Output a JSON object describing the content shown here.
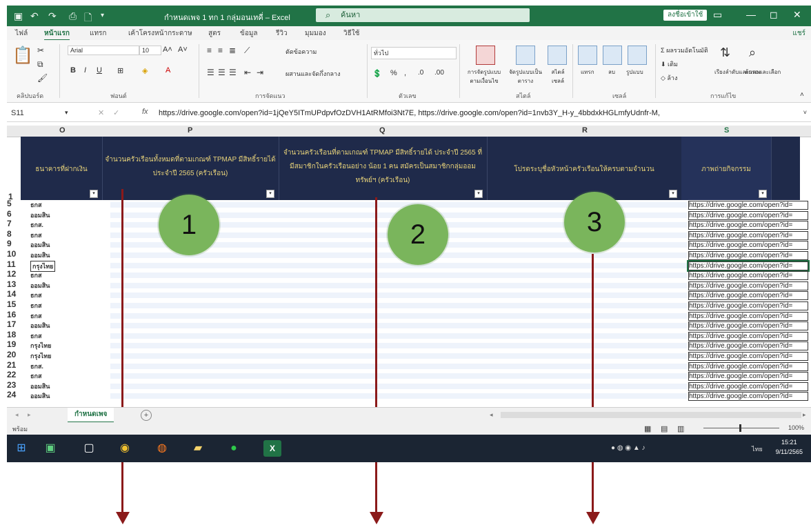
{
  "titlebar": {
    "title": "กำหนดเพจ 1 ทก 1 กลุ่มอนเทคี่ – Excel",
    "search_placeholder": "ค้นหา",
    "signin": "ลงชื่อเข้าใช้"
  },
  "ribbon": {
    "tabs": [
      "ไฟล์",
      "หน้าแรก",
      "แทรก",
      "เค้าโครงหน้ากระดาษ",
      "สูตร",
      "ข้อมูล",
      "รีวิว",
      "มุมมอง",
      "วิธีใช้"
    ],
    "active_tab": "หน้าแรก",
    "share": "แชร์",
    "groups": [
      "คลิปบอร์ด",
      "ฟอนต์",
      "การจัดแนว",
      "ตัวเลข",
      "สไตล์",
      "เซลล์",
      "การแก้ไข"
    ],
    "font_name": "Arial",
    "font_size": "10",
    "number_format": "ทั่วไป",
    "wrap_text": "ตัดข้อความ",
    "merge_center": "ผสานและจัดกึ่งกลาง",
    "conditional_format": "การจัดรูปแบบตามเงื่อนไข",
    "format_table": "จัดรูปแบบเป็นตาราง",
    "cell_styles": "สไตล์เซลล์",
    "insert": "แทรก",
    "delete": "ลบ",
    "format": "รูปแบบ",
    "autosum": "ผลรวมอัตโนมัติ",
    "fill": "เติม",
    "clear": "ล้าง",
    "sort_filter": "เรียงลำดับและกรอง",
    "find_select": "ค้นหาและเลือก"
  },
  "formula_bar": {
    "name_box": "S11",
    "fx": "fx",
    "formula": "https://drive.google.com/open?id=1jQeY5ITmUPdpvfOzDVH1AtRMfoi3Nt7E, https://drive.google.com/open?id=1nvb3Y_H-y_4bbdxkHGLmfyUdnfr-M,"
  },
  "columns": [
    "O",
    "P",
    "Q",
    "R",
    "S"
  ],
  "headers": {
    "O": "ธนาคารที่ฝากเงิน",
    "P": "จำนวนครัวเรือนทั้งหมดที่ตามเกณฑ์ TPMAP มีสิทธิ์รายได้ ประจำปี 2565 (ครัวเรือน)",
    "Q": "จำนวนครัวเรือนที่ตามเกณฑ์ TPMAP มีสิทธิ์รายได้ ประจำปี 2565 ที่มีสมาชิกในครัวเรือนอย่าง น้อย 1 คน สมัครเป็นสมาชิกกลุ่มออมทรัพย์ฯ (ครัวเรือน)",
    "R": "โปรดระบุชื่อหัวหน้าครัวเรือนให้ครบตามจำนวน",
    "S": "ภาพถ่ายกิจกรรม"
  },
  "rows": [
    {
      "num": "5",
      "bank": "ธกส",
      "link": "https://drive.google.com/open?id="
    },
    {
      "num": "6",
      "bank": "ออมสิน",
      "link": "https://drive.google.com/open?id="
    },
    {
      "num": "7",
      "bank": "ธกส.",
      "link": "https://drive.google.com/open?id="
    },
    {
      "num": "8",
      "bank": "ธกส",
      "link": "https://drive.google.com/open?id="
    },
    {
      "num": "9",
      "bank": "ออมสิน",
      "link": "https://drive.google.com/open?id="
    },
    {
      "num": "10",
      "bank": "ออมสิน",
      "link": "https://drive.google.com/open?id="
    },
    {
      "num": "11",
      "bank": "กรุงไทย",
      "link": "https://drive.google.com/open?id="
    },
    {
      "num": "12",
      "bank": "ธกส",
      "link": "https://drive.google.com/open?id="
    },
    {
      "num": "13",
      "bank": "ออมสิน",
      "link": "https://drive.google.com/open?id="
    },
    {
      "num": "14",
      "bank": "ธกส",
      "link": "https://drive.google.com/open?id="
    },
    {
      "num": "15",
      "bank": "ธกส",
      "link": "https://drive.google.com/open?id="
    },
    {
      "num": "16",
      "bank": "ธกส",
      "link": "https://drive.google.com/open?id="
    },
    {
      "num": "17",
      "bank": "ออมสิน",
      "link": "https://drive.google.com/open?id="
    },
    {
      "num": "18",
      "bank": "ธกส",
      "link": "https://drive.google.com/open?id="
    },
    {
      "num": "19",
      "bank": "กรุงไทย",
      "link": "https://drive.google.com/open?id="
    },
    {
      "num": "20",
      "bank": "กรุงไทย",
      "link": "https://drive.google.com/open?id="
    },
    {
      "num": "21",
      "bank": "ธกส.",
      "link": "https://drive.google.com/open?id="
    },
    {
      "num": "22",
      "bank": "ธกส",
      "link": "https://drive.google.com/open?id="
    },
    {
      "num": "23",
      "bank": "ออมสิน",
      "link": "https://drive.google.com/open?id="
    },
    {
      "num": "24",
      "bank": "ออมสิน",
      "link": "https://drive.google.com/open?id="
    }
  ],
  "header_row_num": "1",
  "markers": [
    "1",
    "2",
    "3"
  ],
  "sheet_tab": "กำหนดเพจ",
  "status": {
    "ready": "พร้อม",
    "zoom": "100%"
  },
  "taskbar": {
    "time": "15:21",
    "date": "9/11/2565",
    "lang": "ไทย"
  },
  "colors": {
    "excel_green": "#217346",
    "header_bg": "#1f2a4a",
    "header_text": "#e7d27a",
    "marker_green": "#7ab55c",
    "arrow_red": "#8b1a1a"
  }
}
